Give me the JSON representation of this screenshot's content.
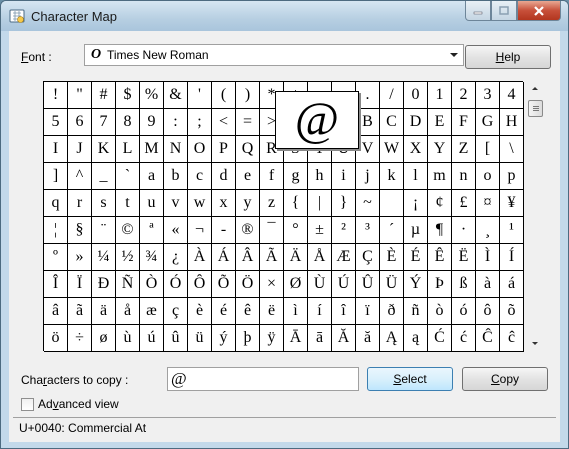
{
  "window": {
    "title": "Character Map",
    "app_icon": "character-map-icon"
  },
  "font": {
    "label_underline": "F",
    "label_rest": "ont :",
    "selected": "Times New Roman",
    "type_glyph": "O"
  },
  "help": {
    "label_underline": "H",
    "label_rest": "elp"
  },
  "grid": {
    "rows": [
      [
        "!",
        "\"",
        "#",
        "$",
        "%",
        "&",
        "'",
        "(",
        ")",
        "*",
        "+",
        ",",
        "-",
        ".",
        "/",
        "0",
        "1",
        "2",
        "3",
        "4"
      ],
      [
        "5",
        "6",
        "7",
        "8",
        "9",
        ":",
        ";",
        "<",
        "=",
        ">",
        "?",
        "@",
        "A",
        "B",
        "C",
        "D",
        "E",
        "F",
        "G",
        "H"
      ],
      [
        "I",
        "J",
        "K",
        "L",
        "M",
        "N",
        "O",
        "P",
        "Q",
        "R",
        "S",
        "T",
        "U",
        "V",
        "W",
        "X",
        "Y",
        "Z",
        "[",
        "\\"
      ],
      [
        "]",
        "^",
        "_",
        "`",
        "a",
        "b",
        "c",
        "d",
        "e",
        "f",
        "g",
        "h",
        "i",
        "j",
        "k",
        "l",
        "m",
        "n",
        "o",
        "p"
      ],
      [
        "q",
        "r",
        "s",
        "t",
        "u",
        "v",
        "w",
        "x",
        "y",
        "z",
        "{",
        "|",
        "}",
        "~",
        " ",
        "¡",
        "¢",
        "£",
        "¤",
        "¥"
      ],
      [
        "¦",
        "§",
        "¨",
        "©",
        "ª",
        "«",
        "¬",
        "-",
        "®",
        "¯",
        "°",
        "±",
        "²",
        "³",
        "´",
        "µ",
        "¶",
        "·",
        "¸",
        "¹"
      ],
      [
        "º",
        "»",
        "¼",
        "½",
        "¾",
        "¿",
        "À",
        "Á",
        "Â",
        "Ã",
        "Ä",
        "Å",
        "Æ",
        "Ç",
        "È",
        "É",
        "Ê",
        "Ë",
        "Ì",
        "Í"
      ],
      [
        "Î",
        "Ï",
        "Ð",
        "Ñ",
        "Ò",
        "Ó",
        "Ô",
        "Õ",
        "Ö",
        "×",
        "Ø",
        "Ù",
        "Ú",
        "Û",
        "Ü",
        "Ý",
        "Þ",
        "ß",
        "à",
        "á"
      ],
      [
        "â",
        "ã",
        "ä",
        "å",
        "æ",
        "ç",
        "è",
        "é",
        "ê",
        "ë",
        "ì",
        "í",
        "î",
        "ï",
        "ð",
        "ñ",
        "ò",
        "ó",
        "ô",
        "õ"
      ],
      [
        "ö",
        "÷",
        "ø",
        "ù",
        "ú",
        "û",
        "ü",
        "ý",
        "þ",
        "ÿ",
        "Ā",
        "ā",
        "Ă",
        "ă",
        "Ą",
        "ą",
        "Ć",
        "ć",
        "Ĉ",
        "ĉ"
      ]
    ],
    "magnified": "@"
  },
  "copy": {
    "label_pre": "Cha",
    "label_underline": "r",
    "label_rest": "acters to copy :",
    "value": "@"
  },
  "select_btn": {
    "label_underline": "S",
    "label_rest": "elect"
  },
  "copy_btn": {
    "label_underline": "C",
    "label_rest": "opy"
  },
  "advanced": {
    "label_pre": "Ad",
    "label_underline": "v",
    "label_rest": "anced view",
    "checked": false
  },
  "status": {
    "text": "U+0040: Commercial At"
  },
  "colors": {
    "title_bar": "#b7cfe2",
    "close_button": "#c7503a",
    "select_button": "#bee6fd"
  }
}
